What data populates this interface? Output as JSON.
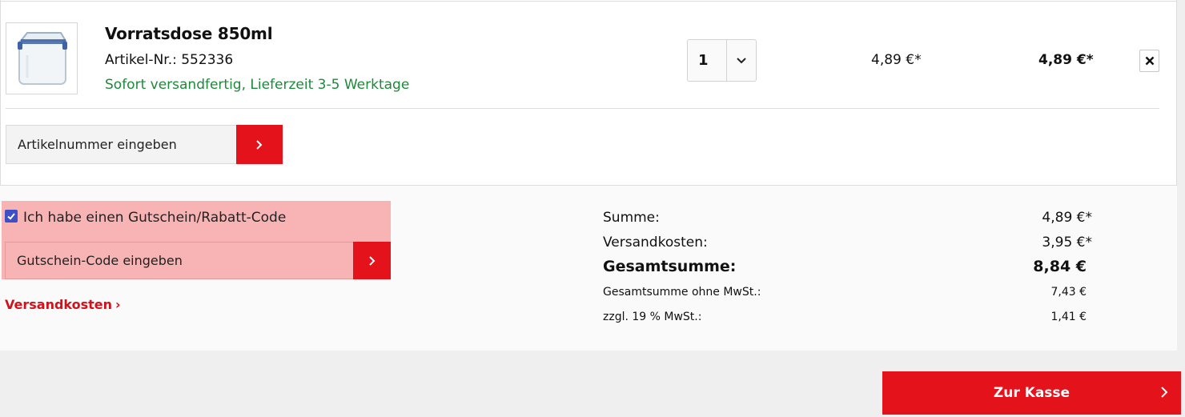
{
  "item": {
    "title": "Vorratsdose 850ml",
    "sku": "Artikel-Nr.: 552336",
    "delivery": "Sofort versandfertig, Lieferzeit 3-5 Werktage",
    "quantity": "1",
    "unit_price": "4,89 €*",
    "total_price": "4,89 €*",
    "remove_label": "✕",
    "thumbnail_icon": "container-icon"
  },
  "article_input": {
    "placeholder": "Artikelnummer eingeben"
  },
  "coupon": {
    "checked": true,
    "label": "Ich habe einen Gutschein/Rabatt-Code",
    "placeholder": "Gutschein-Code eingeben"
  },
  "shipping_link": {
    "label": "Versandkosten",
    "arrow": "›"
  },
  "summary": {
    "subtotal_label": "Summe:",
    "subtotal_value": "4,89 €*",
    "shipping_label": "Versandkosten:",
    "shipping_value": "3,95 €*",
    "total_label": "Gesamtsumme:",
    "total_value": "8,84 €",
    "net_label": "Gesamtsumme ohne MwSt.:",
    "net_value": "7,43 €",
    "vat_label": "zzgl. 19 % MwSt.:",
    "vat_value": "1,41 €"
  },
  "checkout": {
    "label": "Zur Kasse"
  },
  "colors": {
    "accent_red": "#e3121b",
    "delivery_green": "#1d8a3a",
    "coupon_highlight": "#f8b4b4",
    "checkbox_blue": "#3c4fc4"
  }
}
